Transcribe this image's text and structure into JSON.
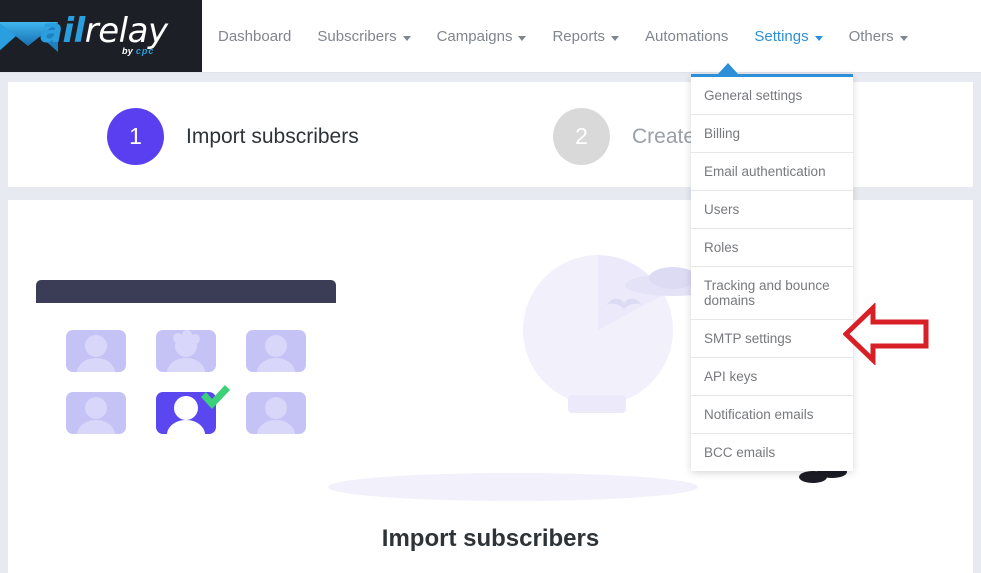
{
  "brand": {
    "logo_primary": "ail",
    "logo_secondary": "relay",
    "logo_tagline_by": "by ",
    "logo_tagline_cpc": "cpc",
    "logo_icon": "envelope-m-icon",
    "accent_blue": "#2e8fd8",
    "logo_blue": "#2a9fe0",
    "logo_bg": "#1c2026"
  },
  "nav": {
    "items": [
      {
        "label": "Dashboard",
        "has_caret": false,
        "active": false
      },
      {
        "label": "Subscribers",
        "has_caret": true,
        "active": false
      },
      {
        "label": "Campaigns",
        "has_caret": true,
        "active": false
      },
      {
        "label": "Reports",
        "has_caret": true,
        "active": false
      },
      {
        "label": "Automations",
        "has_caret": false,
        "active": false
      },
      {
        "label": "Settings",
        "has_caret": true,
        "active": true
      },
      {
        "label": "Others",
        "has_caret": true,
        "active": false
      }
    ]
  },
  "settings_menu": {
    "open": true,
    "items": [
      {
        "label": "General settings"
      },
      {
        "label": "Billing"
      },
      {
        "label": "Email authentication"
      },
      {
        "label": "Users"
      },
      {
        "label": "Roles"
      },
      {
        "label": "Tracking and bounce domains"
      },
      {
        "label": "SMTP settings"
      },
      {
        "label": "API keys"
      },
      {
        "label": "Notification emails"
      },
      {
        "label": "BCC emails"
      }
    ]
  },
  "wizard": {
    "steps": [
      {
        "number": "1",
        "label": "Import subscribers",
        "state": "active",
        "color": "#5a3ff0"
      },
      {
        "number": "2",
        "label": "Create",
        "state": "inactive",
        "color": "#d9d9d9"
      }
    ]
  },
  "content": {
    "title": "Import subscribers",
    "illustration": "import-subscribers-illustration"
  },
  "annotation": {
    "type": "arrow-left-annotation",
    "color": "#d81f26",
    "points_at": "SMTP settings"
  }
}
